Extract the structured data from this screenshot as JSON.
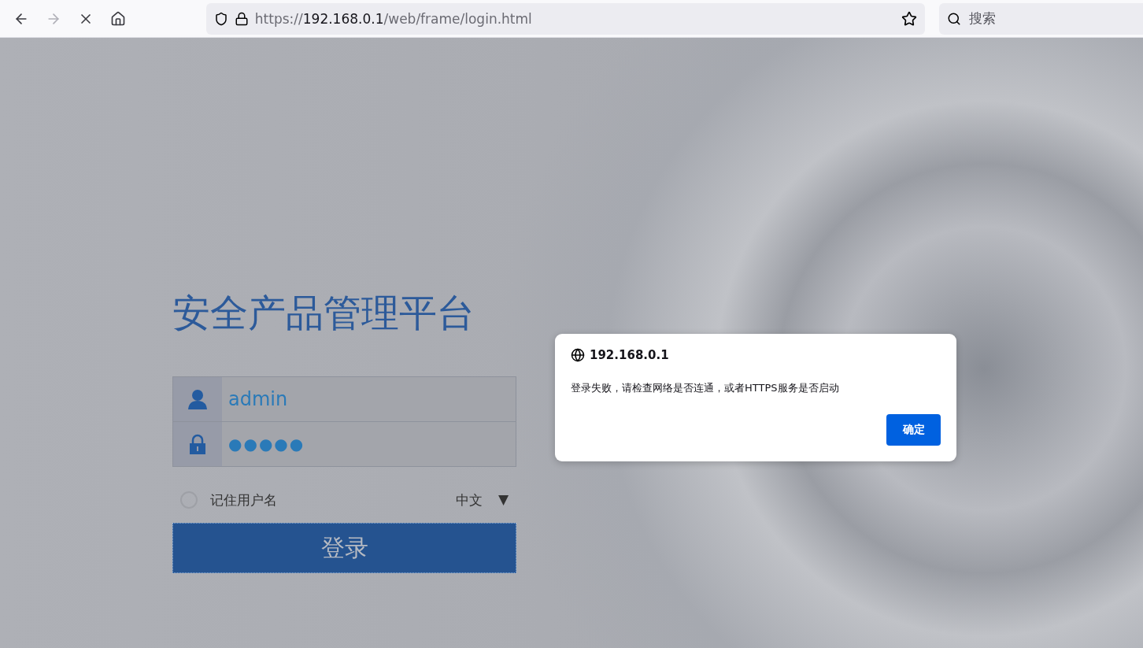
{
  "browser": {
    "back_disabled": false,
    "forward_disabled": true,
    "url": {
      "scheme": "https://",
      "host": "192.168.0.1",
      "path": "/web/frame/login.html"
    },
    "search_placeholder": "搜索"
  },
  "login": {
    "title": "安全产品管理平台",
    "username": "admin",
    "password": "●●●●●",
    "remember": {
      "label": "记住用户名",
      "checked": false
    },
    "language": {
      "value": "中文",
      "arrow": "▼"
    },
    "submit": "登录"
  },
  "dialog": {
    "origin": "192.168.0.1",
    "message": "登录失败，请检查网络是否连通，或者HTTPS服务是否启动",
    "ok": "确定"
  }
}
